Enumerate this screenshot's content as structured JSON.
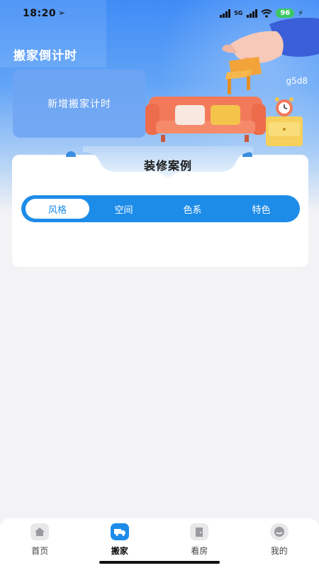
{
  "status_bar": {
    "time": "18:20",
    "location_icon": "location-arrow-icon",
    "signal_label": "5G",
    "battery": "96"
  },
  "header": {
    "title": "搬家倒计时",
    "code": "g5d8"
  },
  "add_card": {
    "label": "新增搬家计时"
  },
  "cases": {
    "title": "装修案例",
    "tabs": [
      {
        "label": "风格",
        "active": true
      },
      {
        "label": "空间",
        "active": false
      },
      {
        "label": "色系",
        "active": false
      },
      {
        "label": "特色",
        "active": false
      }
    ]
  },
  "tabbar": {
    "items": [
      {
        "label": "首页",
        "icon": "home-icon",
        "active": false
      },
      {
        "label": "搬家",
        "icon": "truck-icon",
        "active": true
      },
      {
        "label": "看房",
        "icon": "door-icon",
        "active": false
      },
      {
        "label": "我的",
        "icon": "profile-icon",
        "active": false
      }
    ]
  },
  "colors": {
    "primary": "#1d8ce8",
    "hero_top": "#3f8cf6",
    "battery": "#3cc764"
  }
}
